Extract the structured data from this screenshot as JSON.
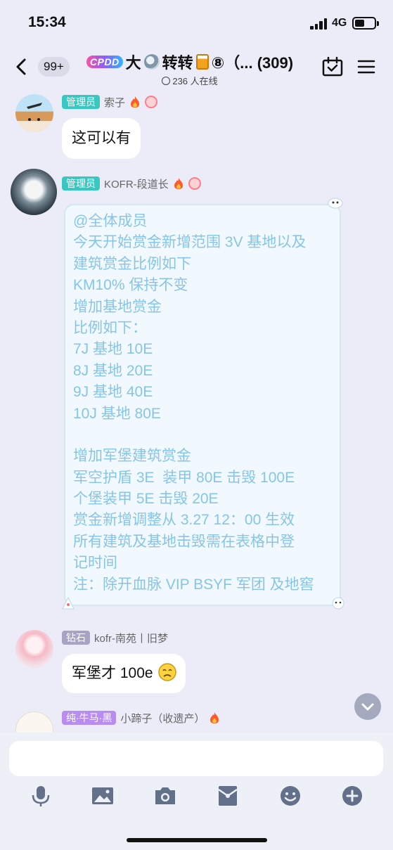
{
  "status_bar": {
    "time": "15:34",
    "network": "4G"
  },
  "header": {
    "unread_count": "99+",
    "logo_text": "CPDD",
    "title_pre": "大",
    "title_mid": "转转",
    "title_post": "⑧（... (309)",
    "online_text": "236 人在线",
    "icons": [
      "chevron-left-icon",
      "calendar-check-icon",
      "menu-icon"
    ]
  },
  "messages": [
    {
      "role": "管理员",
      "name": "索子",
      "text": "这可以有"
    },
    {
      "role": "管理员",
      "name": "KOFR-段道长",
      "notice_lines": [
        "@全体成员",
        "今天开始赏金新增范围 3V 基地以及",
        "建筑赏金比例如下",
        "KM10% 保持不变",
        "增加基地赏金",
        "比例如下：",
        "7J 基地 10E",
        "8J 基地 20E",
        "9J 基地 40E",
        "10J 基地 80E",
        "",
        "增加军堡建筑赏金",
        "军空护盾 3E  装甲 80E 击毁 100E",
        "个堡装甲 5E 击毁 20E",
        "赏金新增调整从 3.27 12：00 生效",
        "所有建筑及基地击毁需在表格中登",
        "记时间",
        "注：除开血脉 VIP BSYF 军团 及地窖"
      ]
    },
    {
      "role": "钻石",
      "name": "kofr-南苑丨旧梦",
      "text": "军堡才 100e"
    },
    {
      "role": "纯·牛马·黑",
      "name": "小蹄子（收遗产）"
    }
  ],
  "input": {
    "placeholder": ""
  },
  "toolbar": [
    "microphone-icon",
    "image-icon",
    "camera-icon",
    "red-packet-icon",
    "emoji-icon",
    "plus-icon"
  ],
  "colors": {
    "background": "#ebecf7",
    "admin_tag": "#38c8c1",
    "notice_text": "#86c5e8",
    "notice_border": "#d2e7f7"
  }
}
